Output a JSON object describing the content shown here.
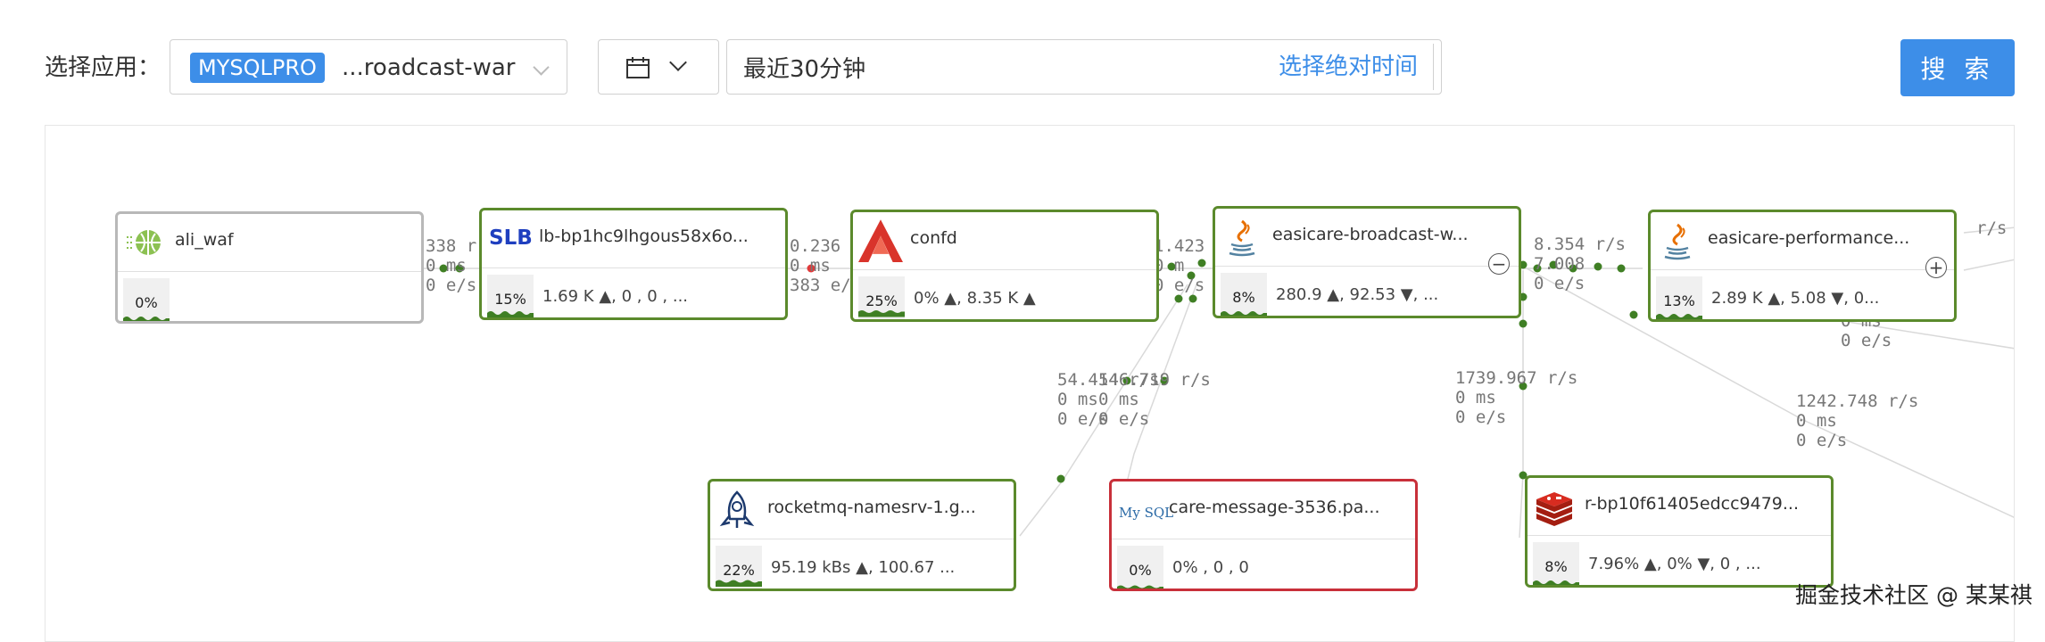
{
  "toolbar": {
    "app_label": "选择应用：",
    "app_tag": "MYSQLPRO",
    "app_value": "...roadcast-war",
    "time_value": "最近30分钟",
    "absolute_time_link": "选择绝对时间",
    "search_label": "搜 索"
  },
  "edge_labels": [
    {
      "text": "338 r\n0 ms\n0 e/s"
    },
    {
      "text": "0.236 r\n0 ms\n383 e/"
    },
    {
      "text": "1.423 r\n0 m\n0 e/s"
    },
    {
      "text": "8.354 r/s\n7.008\n0 e/s"
    },
    {
      "text": "r/s"
    },
    {
      "text": "0 ms\n0 e/s"
    },
    {
      "text": "54.414 r/s\n0 ms\n0 e/s"
    },
    {
      "text": "546.719 r/s\n0 ms\n0 e/s"
    },
    {
      "text": "1739.967 r/s\n0 ms\n0 e/s"
    },
    {
      "text": "1242.748 r/s\n0 ms\n0 e/s"
    }
  ],
  "nodes": [
    {
      "name": "ali_waf",
      "icon": "waf-icon",
      "pct": "0%",
      "stats": ""
    },
    {
      "name": "lb-bp1hc9lhgous58x6o...",
      "icon": "slb-icon",
      "icon_text": "SLB",
      "pct": "15%",
      "stats": "1.69 K ▲, 0  , 0   , ..."
    },
    {
      "name": "confd",
      "icon": "confd-logo-icon",
      "pct": "25%",
      "stats": "0% ▲, 8.35 K ▲"
    },
    {
      "name": "easicare-broadcast-w...",
      "icon": "java-icon",
      "pct": "8%",
      "stats": "280.9   ▲, 92.53  ▼, ..."
    },
    {
      "name": "easicare-performance...",
      "icon": "java-icon",
      "pct": "13%",
      "stats": "2.89 K ▲, 5.08  ▼, 0..."
    },
    {
      "name": "rocketmq-namesrv-1.g...",
      "icon": "rocketmq-icon",
      "pct": "22%",
      "stats": "95.19 kBs ▲, 100.67 ..."
    },
    {
      "name": "care-message-3536.pa...",
      "icon": "mysql-icon",
      "icon_text": "My SQL",
      "pct": "0%",
      "stats": "0% , 0  , 0"
    },
    {
      "name": "r-bp10f61405edcc9479...",
      "icon": "redis-icon",
      "pct": "8%",
      "stats": "7.96% ▲, 0% ▼, 0  , ..."
    }
  ],
  "toggles": {
    "collapse": "−",
    "expand": "+"
  },
  "watermark": "掘金技术社区 @ 某某祺",
  "colors": {
    "accent": "#3d8ee8",
    "healthy": "#5b8a2c",
    "alert": "#c8303a",
    "idle": "#b8b8b8"
  }
}
